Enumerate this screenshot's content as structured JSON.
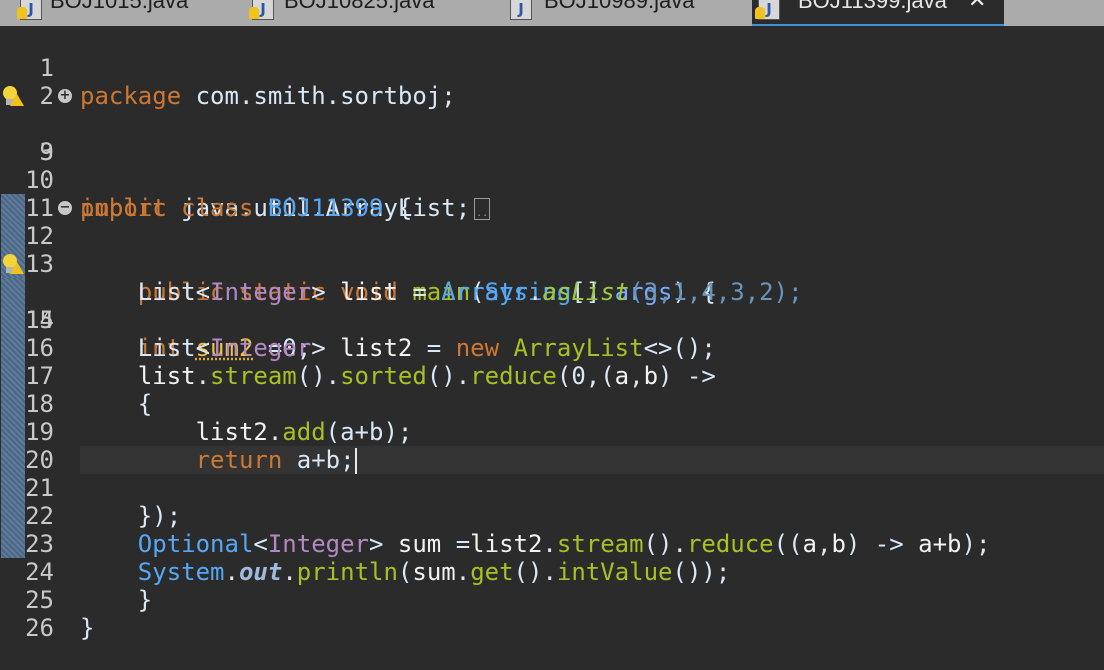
{
  "tabs": [
    {
      "label": "BOJ1015.java",
      "icon": "java-file-warning-icon",
      "active": false
    },
    {
      "label": "BOJ10825.java",
      "icon": "java-file-warning-icon",
      "active": false
    },
    {
      "label": "BOJ10989.java",
      "icon": "java-file-icon",
      "active": false
    },
    {
      "label": "BOJ11399.java",
      "icon": "java-file-warning-icon",
      "active": true,
      "close": "✕"
    }
  ],
  "editor": {
    "lines": [
      {
        "num": "1"
      },
      {
        "num": "2"
      },
      {
        "num": "3"
      },
      {
        "num": "9"
      },
      {
        "num": "10"
      },
      {
        "num": "11"
      },
      {
        "num": "12"
      },
      {
        "num": "13"
      },
      {
        "num": "14"
      },
      {
        "num": "15"
      },
      {
        "num": "16"
      },
      {
        "num": "17"
      },
      {
        "num": "18"
      },
      {
        "num": "19"
      },
      {
        "num": "20"
      },
      {
        "num": "21"
      },
      {
        "num": "22"
      },
      {
        "num": "23"
      },
      {
        "num": "24"
      },
      {
        "num": "25"
      },
      {
        "num": "26"
      }
    ],
    "code": {
      "l1": {
        "kw": "package",
        "rest": " com.smith.sortboj;"
      },
      "l3": {
        "kw": "import",
        "rest": " java.util.ArrayList;"
      },
      "l10": {
        "kw": "public class",
        "cls": "BOJ11399",
        "rest": " {"
      },
      "l12": {
        "kw": "public static void",
        "method": "main",
        "p1": "(",
        "type": "String",
        "p2": "[] ",
        "arg": "args",
        "p3": ") {"
      },
      "l13": {
        "t1": "List",
        "lt": "<",
        "t2": "Integer",
        "gt": "> ",
        "var": "list",
        "eq": " = ",
        "cls": "Arrays",
        "dot": ".",
        "m": "asList",
        "args": "(3,1,4,3,2);"
      },
      "l14": {
        "kw": "int",
        "var": "sum2",
        "rest": " =0;"
      },
      "l15": {
        "t1": "List",
        "lt": "<",
        "t2": "Integer",
        "gt": "> ",
        "var": "list2",
        "eq": " = ",
        "kw": "new",
        "cls": "ArrayList",
        "rest": "<>();"
      },
      "l16": {
        "var": "list",
        "d1": ".",
        "m1": "stream",
        "p1": "().",
        "m2": "sorted",
        "p2": "().",
        "m3": "reduce",
        "p3": "(0,(",
        "a": "a",
        "c": ",",
        "b": "b",
        "p4": ") ->"
      },
      "l17": {
        "text": "{"
      },
      "l18": {
        "var": "list2",
        "d": ".",
        "m": "add",
        "args": "(a+b);"
      },
      "l19": {
        "kw": "return",
        "rest": " a+b;"
      },
      "l21": {
        "text": "});"
      },
      "l22": {
        "t1": "Optional",
        "lt": "<",
        "t2": "Integer",
        "gt": "> ",
        "var": "sum",
        "eq": " =",
        "v2": "list2",
        "d1": ".",
        "m1": "stream",
        "p1": "().",
        "m2": "reduce",
        "p2": "((",
        "a": "a",
        "c": ",",
        "b": "b",
        "p3": ") -> ",
        "e": "a+b",
        "p4": ");"
      },
      "l23": {
        "cls": "System",
        "d1": ".",
        "f": "out",
        "d2": ".",
        "m1": "println",
        "p1": "(",
        "v": "sum",
        "d3": ".",
        "m2": "get",
        "p2": "().",
        "m3": "intValue",
        "p3": "());"
      },
      "l24": {
        "text": "}"
      },
      "l25": {
        "text": "}"
      }
    },
    "current_line": "19",
    "colors": {
      "background": "#2b2b2b",
      "keyword": "#cc7832",
      "class": "#56a8f5",
      "type_param": "#b389c5",
      "method": "#a8c023",
      "literal": "#6897bb"
    }
  }
}
